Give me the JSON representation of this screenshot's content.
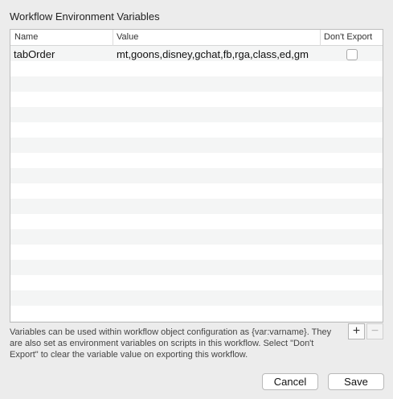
{
  "dialog": {
    "title": "Workflow Environment Variables"
  },
  "table": {
    "columns": {
      "name": "Name",
      "value": "Value",
      "dont_export": "Don't Export"
    },
    "rows": [
      {
        "name": "tabOrder",
        "value": "mt,goons,disney,gchat,fb,rga,class,ed,gm",
        "dont_export": false
      }
    ]
  },
  "description": "Variables can be used within workflow object configuration as {var:varname}. They are also set as environment variables on scripts in this workflow. Select \"Don't Export\" to clear the variable value on exporting this workflow.",
  "controls": {
    "add_label": "+",
    "remove_label": "−"
  },
  "buttons": {
    "cancel_label": "Cancel",
    "save_label": "Save"
  }
}
